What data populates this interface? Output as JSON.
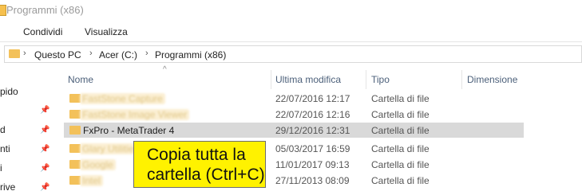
{
  "window": {
    "title": "Programmi (x86)"
  },
  "ribbon": {
    "tabs": [
      "Condividi",
      "Visualizza"
    ]
  },
  "address": {
    "crumbs": [
      "Questo PC",
      "Acer (C:)",
      "Programmi (x86)"
    ]
  },
  "nav": {
    "items": [
      "pido",
      "d",
      "nti",
      "i",
      "rive"
    ]
  },
  "columns": {
    "name": "Nome",
    "modified": "Ultima modifica",
    "type": "Tipo",
    "size": "Dimensione"
  },
  "files": [
    {
      "name": "FastStone Capture",
      "modified": "22/07/2016 12:17",
      "type": "Cartella di file"
    },
    {
      "name": "FastStone Image Viewer",
      "modified": "22/07/2016 12:16",
      "type": "Cartella di file"
    },
    {
      "name": "FxPro - MetaTrader 4",
      "modified": "29/12/2016 12:31",
      "type": "Cartella di file"
    },
    {
      "name": "Glary Utilities 5",
      "modified": "05/03/2017 16:59",
      "type": "Cartella di file"
    },
    {
      "name": "Google",
      "modified": "11/01/2017 09:13",
      "type": "Cartella di file"
    },
    {
      "name": "Intel",
      "modified": "27/11/2013 08:09",
      "type": "Cartella di file"
    }
  ],
  "callout": {
    "line1": "Copia tutta la",
    "line2": "cartella (Ctrl+C)"
  },
  "colors": {
    "selected_row": "#d9d9d9",
    "callout_bg": "#fff200",
    "folder": "#f3c15a"
  }
}
